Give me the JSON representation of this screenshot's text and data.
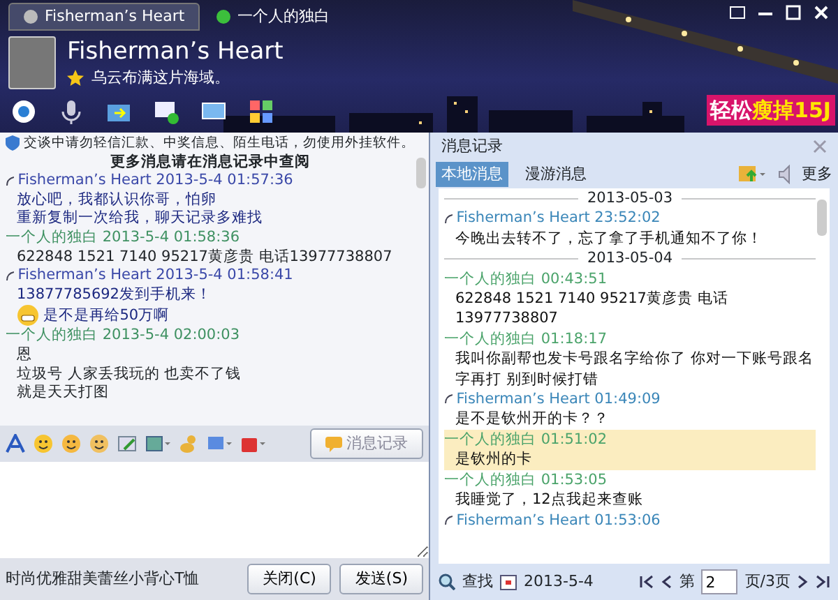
{
  "window": {
    "tabs": [
      {
        "label": "Fisherman’s Heart",
        "selected": true,
        "online": false
      },
      {
        "label": "一个人的独白",
        "selected": false,
        "online": true
      }
    ]
  },
  "profile": {
    "name": "Fisherman’s Heart",
    "signature": "乌云布满这片海域。"
  },
  "ad": {
    "text": "轻松",
    "highlight": "瘦掉15J"
  },
  "chat": {
    "notice": "交谈中请勿轻信汇款、中奖信息、陌生电话，勿使用外挂软件。",
    "more_hint": "更多消息请在消息记录中查阅",
    "messages": [
      {
        "kind": "self",
        "sender": "Fisherman’s Heart",
        "time": "2013-5-4 01:57:36",
        "lines": [
          {
            "text": "放心吧，我都认识你哥，怕卵",
            "emoji": false
          },
          {
            "text": "重新复制一次给我，聊天记录多难找",
            "emoji": false
          }
        ]
      },
      {
        "kind": "other",
        "sender": "一个人的独白",
        "time": "2013-5-4 01:58:36",
        "lines": [
          {
            "text": "622848  1521  7140  95217黄彦贵    电话13977738807",
            "emoji": false
          }
        ]
      },
      {
        "kind": "self",
        "sender": "Fisherman’s Heart",
        "time": "2013-5-4 01:58:41",
        "lines": [
          {
            "text": "13877785692发到手机来！",
            "emoji": false
          },
          {
            "text": "是不是再给50万啊",
            "emoji": true
          }
        ]
      },
      {
        "kind": "other",
        "sender": "一个人的独白",
        "time": "2013-5-4 02:00:03",
        "lines": [
          {
            "text": "恩",
            "emoji": false
          },
          {
            "text": "垃圾号  人家丢我玩的  也卖不了钱",
            "emoji": false
          },
          {
            "text": "就是天天打图",
            "emoji": false
          }
        ]
      }
    ],
    "history_button": "消息记录",
    "status_text": "时尚优雅甜美蕾丝小背心T恤",
    "close_button": "关闭(C)",
    "send_button": "发送(S)"
  },
  "history": {
    "title": "消息记录",
    "tabs": [
      {
        "label": "本地消息",
        "selected": true
      },
      {
        "label": "漫游消息",
        "selected": false
      }
    ],
    "more": "更多",
    "entries": [
      {
        "kind": "date",
        "text": "2013-05-03"
      },
      {
        "kind": "self",
        "sender": "Fisherman’s Heart",
        "time": "23:52:02",
        "text": "今晚出去转不了，忘了拿了手机通知不了你！",
        "highlighted": false
      },
      {
        "kind": "date",
        "text": "2013-05-04"
      },
      {
        "kind": "other",
        "sender": "一个人的独白",
        "time": "00:43:51",
        "text": "622848 1521 7140 95217黄彦贵   电话13977738807",
        "highlighted": false
      },
      {
        "kind": "other",
        "sender": "一个人的独白",
        "time": "01:18:17",
        "text": "我叫你副帮也发卡号跟名字给你了  你对一下账号跟名字再打  别到时候打错",
        "highlighted": false
      },
      {
        "kind": "self",
        "sender": "Fisherman’s Heart",
        "time": "01:49:09",
        "text": "是不是钦州开的卡？？",
        "highlighted": false
      },
      {
        "kind": "other",
        "sender": "一个人的独白",
        "time": "01:51:02",
        "text": "是钦州的卡",
        "highlighted": true
      },
      {
        "kind": "other",
        "sender": "一个人的独白",
        "time": "01:53:05",
        "text": "我睡觉了，12点我起来查账",
        "highlighted": false
      },
      {
        "kind": "self",
        "sender": "Fisherman’s Heart",
        "time": "01:53:06"
      }
    ],
    "find": "查找",
    "date": "2013-5-4",
    "page_prefix": "第",
    "page": "2",
    "page_suffix": "页/3页"
  }
}
